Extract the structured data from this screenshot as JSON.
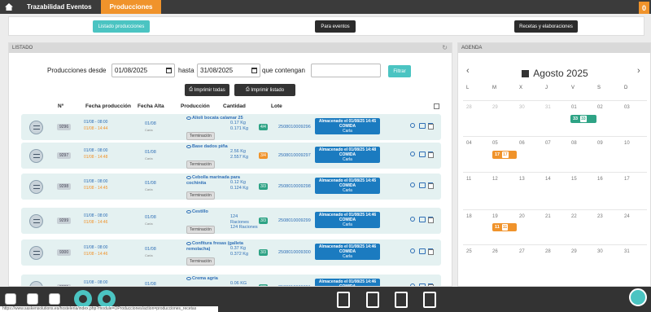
{
  "nav": {
    "tabs": [
      "Trazabilidad Eventos",
      "Producciones"
    ],
    "badge": "0"
  },
  "actions": {
    "listado": "Listado producciones",
    "eventos": "Para eventos",
    "recetas": "Recetas y elaboraciones"
  },
  "listado": {
    "title": "LISTADO",
    "filter": {
      "desde_label": "Producciones desde",
      "desde_value": "01/08/2025",
      "hasta_label": "hasta",
      "hasta_value": "31/08/2025",
      "contengan_label": "que contengan",
      "contengan_value": "",
      "button": "Filtrar"
    },
    "print_all": "Imprimir todas",
    "print_list": "Imprimir listado",
    "columns": [
      "Nº",
      "Fecha producción",
      "Fecha Alta",
      "Producción",
      "Cantidad",
      "Lote"
    ],
    "rows": [
      {
        "num": "9296",
        "d1": "01/08 - 08:00",
        "d2": "01/08 - 14:44",
        "alta": "01/08",
        "alta2": "Carla",
        "name": "Alioli bocata calamar 25",
        "status": "Terminación",
        "cant1": "0.17 Kg",
        "cant2": "0.171 Kg",
        "cant3": "",
        "frac": "4/4",
        "lote": "2508010009296",
        "alm1": "Almacenado el 01/08/25 14:45",
        "alm2": "COMIDA",
        "alm3": "Carla"
      },
      {
        "num": "9297",
        "d1": "01/08 - 08:00",
        "d2": "01/08 - 14:48",
        "alta": "01/08",
        "alta2": "Carla",
        "name": "Base dados piña",
        "status": "Terminación",
        "cant1": "2.56 Kg",
        "cant2": "2.557 Kg",
        "cant3": "",
        "frac": "3/4",
        "lote": "2508010009297",
        "alm1": "Almacenado el 01/08/25 14:48",
        "alm2": "COMIDA",
        "alm3": "Carla"
      },
      {
        "num": "9298",
        "d1": "01/08 - 08:00",
        "d2": "01/08 - 14:45",
        "alta": "01/08",
        "alta2": "Carla",
        "name": "Cebolla marinada para cochinita",
        "status": "Terminación",
        "cant1": "0.12 Kg",
        "cant2": "0.124 Kg",
        "cant3": "",
        "frac": "3/3",
        "lote": "2508010009298",
        "alm1": "Almacenado el 01/08/25 14:45",
        "alm2": "COMIDA",
        "alm3": "Carla"
      },
      {
        "num": "9299",
        "d1": "01/08 - 08:00",
        "d2": "01/08 - 14:46",
        "alta": "01/08",
        "alta2": "Carla",
        "name": "Cestillo",
        "status": "Terminación",
        "cant1": "124",
        "cant2": "Raciones",
        "cant3": "124 Raciones",
        "frac": "3/3",
        "lote": "2508010009299",
        "alm1": "Almacenado el 01/08/25 14:46",
        "alm2": "COMIDA",
        "alm3": "Carla"
      },
      {
        "num": "9300",
        "d1": "01/08 - 08:00",
        "d2": "01/08 - 14:46",
        "alta": "01/08",
        "alta2": "Carla",
        "name": "Confitura fresas (galleta remolacha)",
        "status": "Terminación",
        "cant1": "0.37 Kg",
        "cant2": "0.372 Kg",
        "cant3": "",
        "frac": "3/3",
        "lote": "2508010009300",
        "alm1": "Almacenado el 01/08/25 14:46",
        "alm2": "COMIDA",
        "alm3": "Carla"
      },
      {
        "num": "9301",
        "d1": "01/08 - 08:00",
        "d2": "01/08 - 14:46",
        "alta": "01/08",
        "alta2": "Carla",
        "name": "Crema agria",
        "status": "",
        "cant1": "0.06 KG",
        "cant2": "0.059 Kg",
        "cant3": "",
        "frac": "3/3",
        "lote": "2508010009301",
        "alm1": "Almacenado el 01/08/25 14:46",
        "alm2": "COMIDA",
        "alm3": ""
      }
    ]
  },
  "agenda": {
    "title": "AGENDA",
    "month": "Agosto 2025",
    "dow": [
      "L",
      "M",
      "X",
      "J",
      "V",
      "S",
      "D"
    ],
    "weeks": [
      [
        "28",
        "29",
        "30",
        "31",
        "01",
        "02",
        "03"
      ],
      [
        "04",
        "05",
        "06",
        "07",
        "08",
        "09",
        "10"
      ],
      [
        "11",
        "12",
        "13",
        "14",
        "15",
        "16",
        "17"
      ],
      [
        "18",
        "19",
        "20",
        "21",
        "22",
        "23",
        "24"
      ],
      [
        "25",
        "26",
        "27",
        "28",
        "29",
        "30",
        "31"
      ]
    ],
    "events": [
      {
        "count": "33",
        "sub": "33",
        "color": "#2ea385"
      },
      {
        "count": "17",
        "sub": "17",
        "color": "#f0932b"
      },
      {
        "count": "11",
        "sub": "11",
        "color": "#f0932b"
      }
    ]
  },
  "footer": {
    "url": "https://www.saskensolutions.es/hosteleria/index.php?module=OProducciones/action=producciones_recetas"
  }
}
